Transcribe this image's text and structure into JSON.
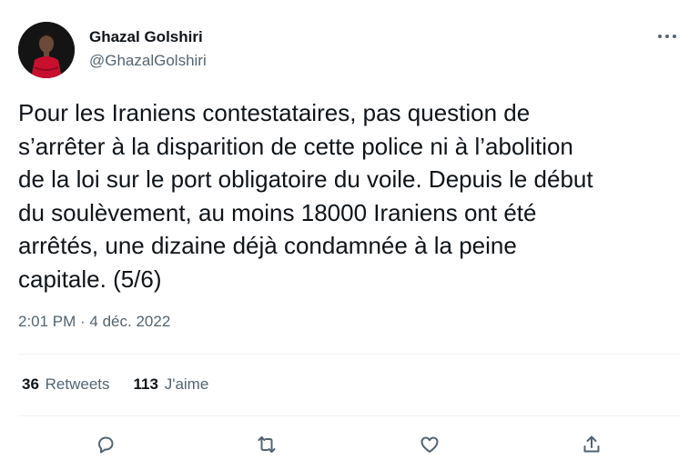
{
  "author": {
    "name": "Ghazal Golshiri",
    "handle": "@GhazalGolshiri"
  },
  "tweet": {
    "text": "Pour les Iraniens contestataires, pas question de\ns’arrêter à la disparition de cette police ni à l’abolition\nde la loi sur le port obligatoire du voile. Depuis le début\ndu soulèvement, au moins 18000 Iraniens ont été\narrêtés, une dizaine déjà condamnée à la peine\ncapitale. (5/6)",
    "timestamp": "2:01 PM · 4 déc. 2022"
  },
  "stats": {
    "retweets_count": "36",
    "retweets_label": "Retweets",
    "likes_count": "113",
    "likes_label": "J'aime"
  },
  "icons": {
    "more": "more-horizontal-icon",
    "reply": "reply-icon",
    "retweet": "retweet-icon",
    "like": "heart-icon",
    "share": "share-icon"
  },
  "colors": {
    "text_primary": "#0f1419",
    "text_secondary": "#536471",
    "divider": "#eff3f4",
    "avatar_dress": "#c8102e"
  }
}
